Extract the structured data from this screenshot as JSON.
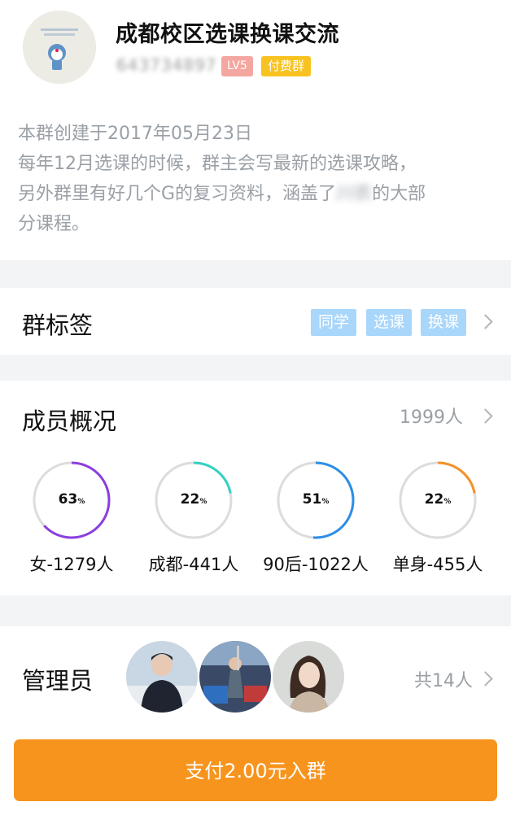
{
  "group": {
    "title": "成都校区选课换课交流",
    "id": "643734897",
    "level": "LV5",
    "paid_badge": "付费群"
  },
  "description": {
    "lines": [
      "本群创建于2017年05月23日",
      "每年12月选课的时候，群主会写最新的选课攻略，",
      "另外群里有好几个G的复习资料，涵盖了",
      "分课程。"
    ],
    "line3_blurred": "川农",
    "line3_tail": "的大部"
  },
  "tags": {
    "title": "群标签",
    "items": [
      "同学",
      "选课",
      "换课"
    ]
  },
  "members": {
    "title": "成员概况",
    "count": "1999人",
    "stats": [
      {
        "percent": 63,
        "label": "女-1279人",
        "color": "#8a3fe0"
      },
      {
        "percent": 22,
        "label": "成都-441人",
        "color": "#35d1c4"
      },
      {
        "percent": 51,
        "label": "90后-1022人",
        "color": "#2b8ee8"
      },
      {
        "percent": 22,
        "label": "单身-455人",
        "color": "#f5922a"
      }
    ],
    "percent_sign": "%"
  },
  "admins": {
    "title": "管理员",
    "count": "共14人"
  },
  "pay_button": {
    "label": "支付2.00元入群"
  }
}
